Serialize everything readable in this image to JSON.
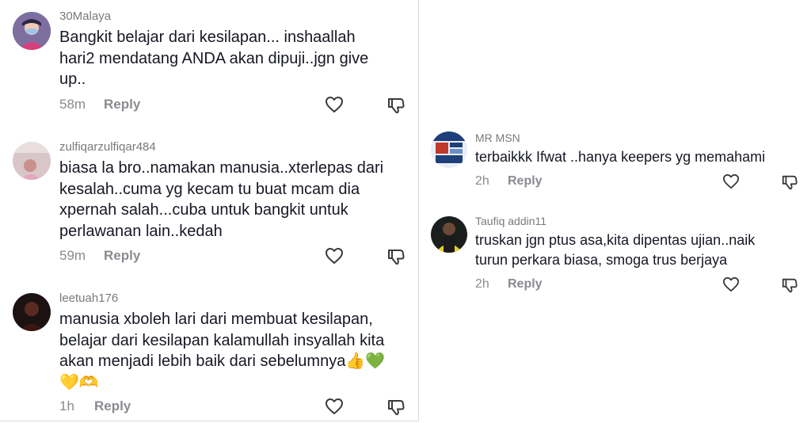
{
  "left_comments": [
    {
      "username": "30Malaya",
      "text": "Bangkit belajar dari kesilapan... inshaallah\nhari2 mendatang ANDA akan dipuji..jgn give\nup..",
      "time": "58m",
      "reply": "Reply"
    },
    {
      "username": "zulfiqarzulfiqar484",
      "text": "biasa la bro..namakan manusia..xterlepas dari\nkesalah..cuma yg kecam tu buat mcam dia\nxpernah salah...cuba untuk bangkit untuk\nperlawanan lain..kedah",
      "time": "59m",
      "reply": "Reply"
    },
    {
      "username": "leetuah176",
      "text": "manusia xboleh lari dari membuat kesilapan,\nbelajar dari kesilapan kalamullah insyallah kita\nakan menjadi lebih baik dari sebelumnya👍💚\n💛🫶",
      "time": "1h",
      "reply": "Reply"
    }
  ],
  "right_comments": [
    {
      "username": "MR MSN",
      "text": "terbaikkk Ifwat ..hanya keepers yg memahami",
      "time": "2h",
      "reply": "Reply"
    },
    {
      "username": "Taufiq addin11",
      "text": "truskan jgn ptus asa,kita dipentas ujian..naik\nturun perkara biasa, smoga trus berjaya",
      "time": "2h",
      "reply": "Reply"
    }
  ],
  "icons": {
    "like": "heart-outline-icon",
    "dislike": "thumbs-down-outline-icon"
  },
  "colors": {
    "text": "#161823",
    "muted": "#8a8b91",
    "username": "#7a7a7a"
  }
}
